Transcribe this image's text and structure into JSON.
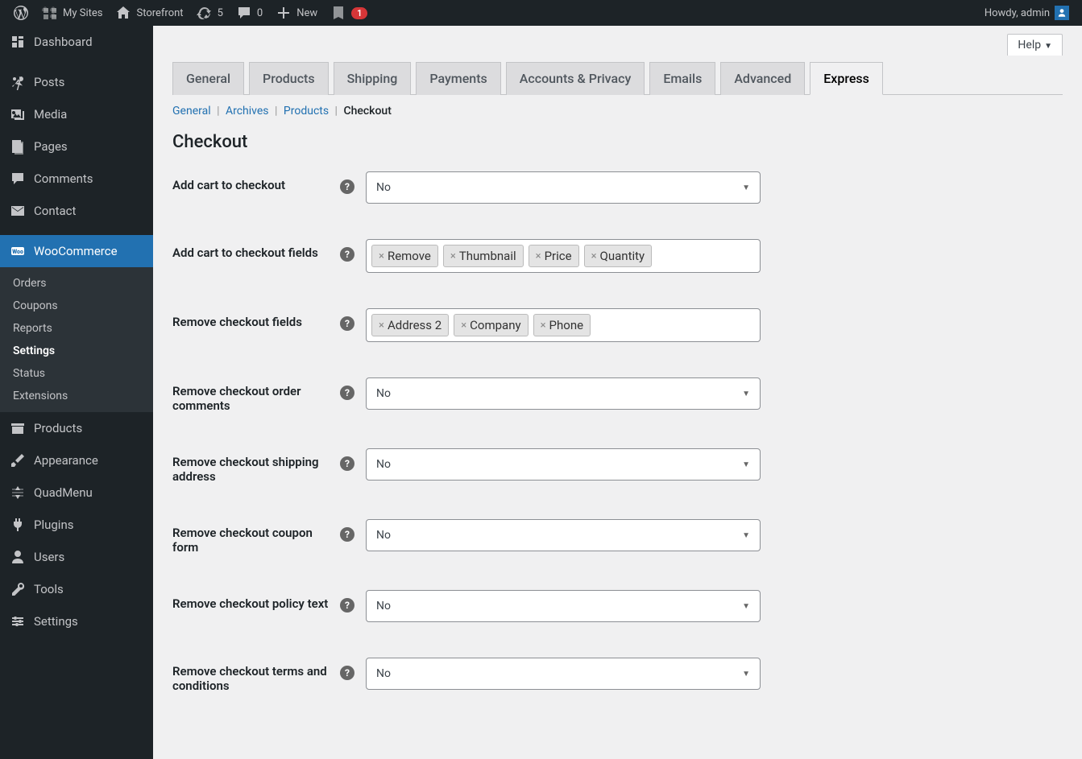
{
  "adminbar": {
    "my_sites": "My Sites",
    "site_name": "Storefront",
    "updates": "5",
    "comments": "0",
    "new": "New",
    "yoast_badge": "1",
    "howdy": "Howdy, admin"
  },
  "sidebar": {
    "items": [
      {
        "label": "Dashboard",
        "icon": "dashboard"
      },
      {
        "label": "Posts",
        "icon": "pin"
      },
      {
        "label": "Media",
        "icon": "media"
      },
      {
        "label": "Pages",
        "icon": "pages"
      },
      {
        "label": "Comments",
        "icon": "comment"
      },
      {
        "label": "Contact",
        "icon": "mail"
      },
      {
        "label": "WooCommerce",
        "icon": "woo",
        "active": true
      },
      {
        "label": "Products",
        "icon": "archive"
      },
      {
        "label": "Appearance",
        "icon": "brush"
      },
      {
        "label": "QuadMenu",
        "icon": "quad"
      },
      {
        "label": "Plugins",
        "icon": "plug"
      },
      {
        "label": "Users",
        "icon": "user"
      },
      {
        "label": "Tools",
        "icon": "wrench"
      },
      {
        "label": "Settings",
        "icon": "sliders"
      }
    ],
    "submenu": [
      {
        "label": "Orders"
      },
      {
        "label": "Coupons"
      },
      {
        "label": "Reports"
      },
      {
        "label": "Settings",
        "active": true
      },
      {
        "label": "Status"
      },
      {
        "label": "Extensions"
      }
    ]
  },
  "help": "Help",
  "tabs": [
    "General",
    "Products",
    "Shipping",
    "Payments",
    "Accounts & Privacy",
    "Emails",
    "Advanced",
    "Express"
  ],
  "active_tab": "Express",
  "subnav": {
    "links": [
      "General",
      "Archives",
      "Products"
    ],
    "current": "Checkout"
  },
  "section_heading": "Checkout",
  "fields": {
    "add_cart": {
      "label": "Add cart to checkout",
      "value": "No"
    },
    "add_cart_fields": {
      "label": "Add cart to checkout fields",
      "tags": [
        "Remove",
        "Thumbnail",
        "Price",
        "Quantity"
      ]
    },
    "remove_fields": {
      "label": "Remove checkout fields",
      "tags": [
        "Address 2",
        "Company",
        "Phone"
      ]
    },
    "remove_comments": {
      "label": "Remove checkout order comments",
      "value": "No"
    },
    "remove_shipping": {
      "label": "Remove checkout shipping address",
      "value": "No"
    },
    "remove_coupon": {
      "label": "Remove checkout coupon form",
      "value": "No"
    },
    "remove_policy": {
      "label": "Remove checkout policy text",
      "value": "No"
    },
    "remove_terms": {
      "label": "Remove checkout terms and conditions",
      "value": "No"
    }
  }
}
